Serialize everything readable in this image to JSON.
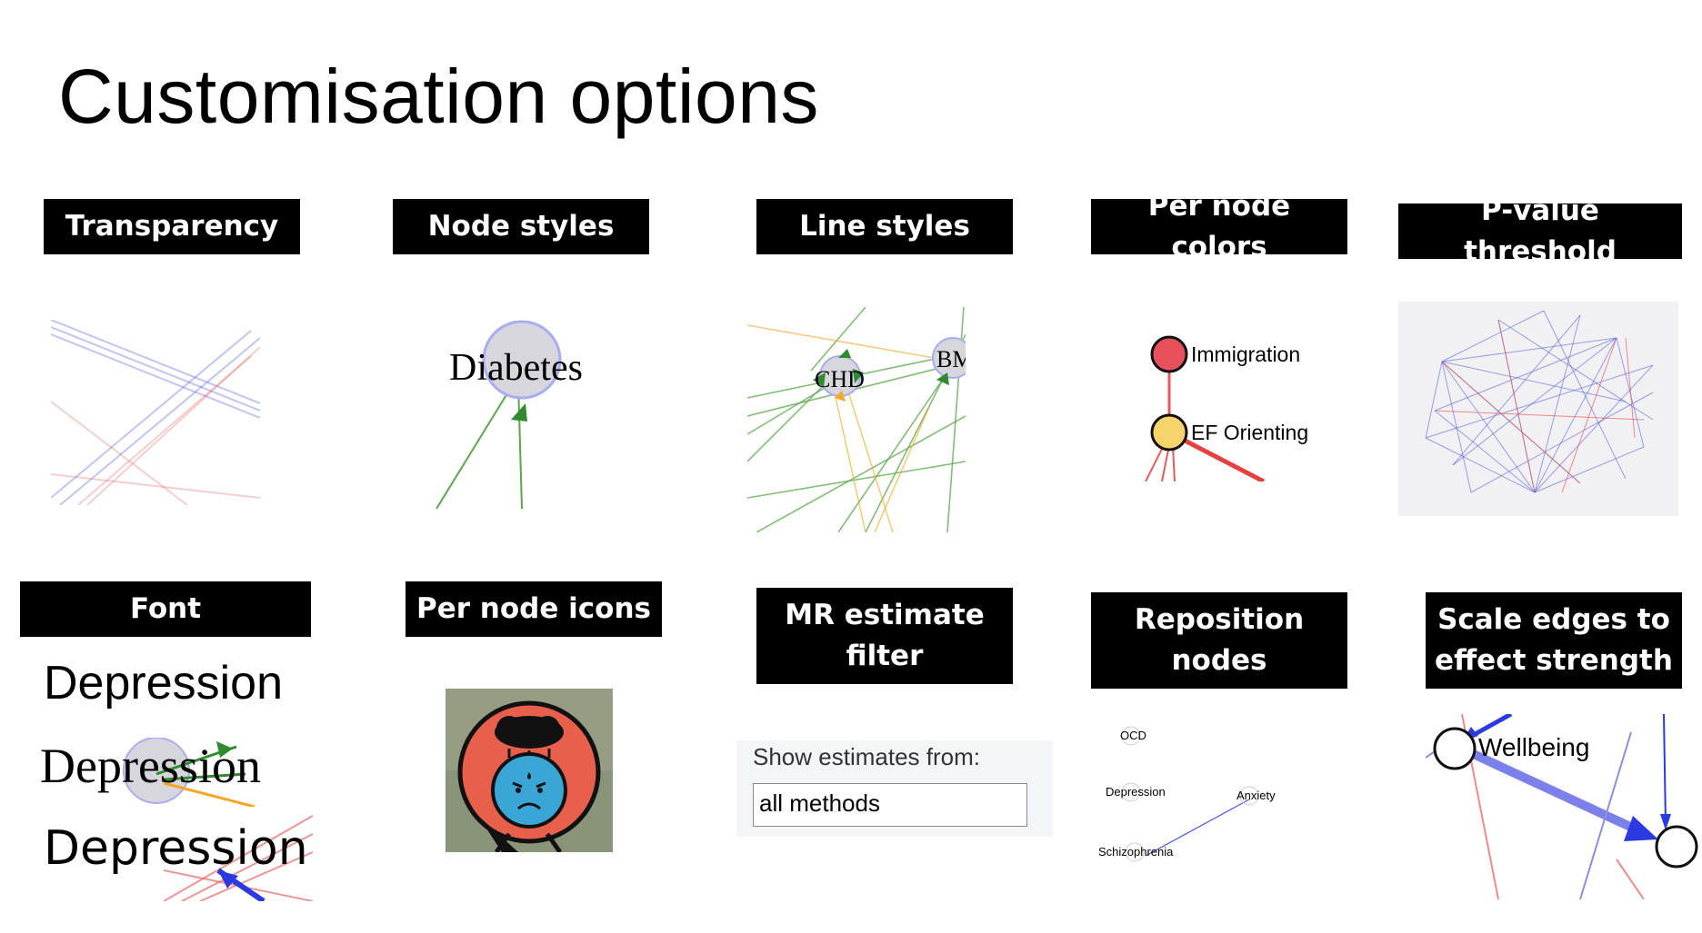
{
  "slide": {
    "title": "Customisation options"
  },
  "options": {
    "transparency": "Transparency",
    "node_styles": "Node styles",
    "line_styles": "Line styles",
    "per_node_colors": "Per node colors",
    "p_value_threshold": "P-value threshold",
    "font": "Font",
    "per_node_icons": "Per node icons",
    "mr_estimate_filter_line1": "MR estimate",
    "mr_estimate_filter_line2": "filter",
    "reposition_nodes_line1": "Reposition",
    "reposition_nodes_line2": "nodes",
    "scale_edges_line1": "Scale edges to",
    "scale_edges_line2": "effect strength"
  },
  "examples": {
    "node_styles_node": "Diabetes",
    "line_styles_node_a": "CHD",
    "line_styles_node_b": "BM",
    "per_node_colors": {
      "node_a": "Immigration",
      "node_b": "EF Orienting",
      "node_a_color": "#e8505b",
      "node_b_color": "#f7d36b"
    },
    "font_samples": [
      "Depression",
      "Depression",
      "Depression"
    ],
    "mr_filter": {
      "caption": "Show estimates from:",
      "selected": "all methods"
    },
    "reposition_nodes": [
      "OCD",
      "Depression",
      "Anxiety",
      "Schizophrenia"
    ],
    "scale_edges_node": "Wellbeing"
  },
  "colors": {
    "label_bg": "#000000",
    "label_text": "#ffffff",
    "blue_edge": "#4b55e6",
    "red_edge": "#e85a5a",
    "green_edge": "#5aa84a",
    "orange_edge": "#f5a623"
  }
}
